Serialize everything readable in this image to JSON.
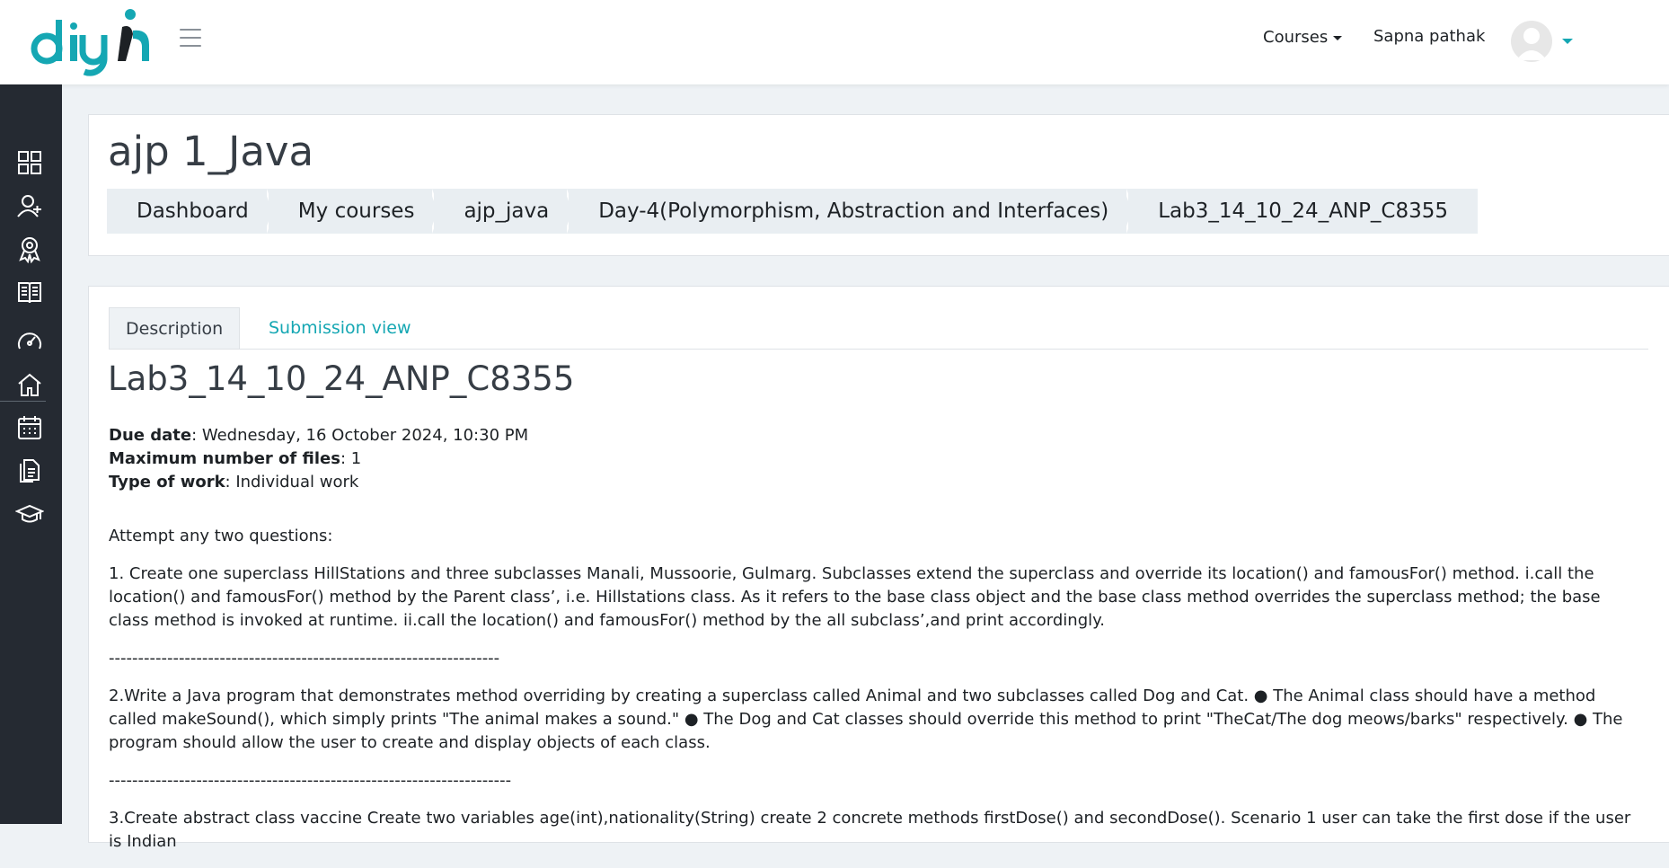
{
  "brand": {
    "name": "diyi",
    "accent": "#15a7b3",
    "dark": "#1d2125"
  },
  "nav": {
    "courses_label": "Courses",
    "user_name": "Sapna pathak"
  },
  "sidebar": {
    "items": [
      {
        "icon": "grid-icon"
      },
      {
        "icon": "user-icon"
      },
      {
        "icon": "badge-icon"
      },
      {
        "icon": "book-icon"
      },
      {
        "icon": "dashboard-icon"
      },
      {
        "icon": "home-icon"
      },
      {
        "icon": "calendar-icon"
      },
      {
        "icon": "files-icon"
      },
      {
        "icon": "graduation-cap-icon"
      }
    ]
  },
  "header": {
    "title": "ajp 1_Java",
    "breadcrumbs": [
      "Dashboard",
      "My courses",
      "ajp_java",
      "Day-4(Polymorphism, Abstraction and Interfaces)",
      "Lab3_14_10_24_ANP_C8355"
    ]
  },
  "tabs": [
    {
      "label": "Description",
      "active": true
    },
    {
      "label": "Submission view",
      "active": false
    }
  ],
  "activity": {
    "title": "Lab3_14_10_24_ANP_C8355",
    "due_date_label": "Due date",
    "due_date_value": ": Wednesday, 16 October 2024, 10:30 PM",
    "max_files_label": "Maximum number of files",
    "max_files_value": ": 1",
    "work_type_label": "Type of work",
    "work_type_value": ": Individual work"
  },
  "description": {
    "intro": "Attempt any two questions:",
    "q1": "1. Create one superclass HillStations and three subclasses Manali, Mussoorie, Gulmarg. Subclasses extend the superclass and override its location() and famousFor() method. i.call the location() and famousFor() method by the Parent class’, i.e. Hillstations class. As it refers to the base class object and the base class method overrides the superclass method; the base class method is invoked at runtime. ii.call the location() and famousFor() method by the all subclass’,and print accordingly.",
    "sep1": "-------------------------------------------------------------------",
    "q2": "2.Write a Java program that demonstrates method overriding by creating a superclass called Animal and two subclasses called Dog and Cat. ● The Animal class should have a method called makeSound(), which simply prints \"The animal makes a sound.\" ● The Dog and Cat classes should override this method to print \"TheCat/The dog meows/barks\" respectively. ● The program should allow the user to create and display objects of each class.",
    "sep2": "---------------------------------------------------------------------",
    "q3": "3.Create abstract class vaccine Create two variables age(int),nationality(String) create 2 concrete methods firstDose() and secondDose(). Scenario 1 user can take the first dose if the user is Indian"
  }
}
